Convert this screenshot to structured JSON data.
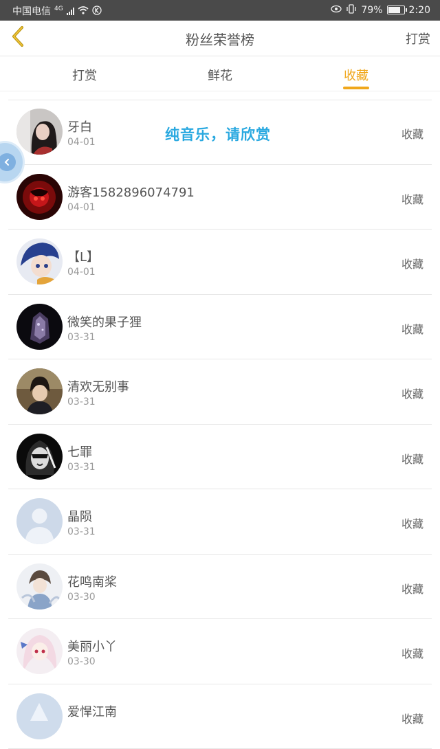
{
  "status_bar": {
    "carrier": "中国电信",
    "network": "4G",
    "battery": "79%",
    "battery_level": 0.79,
    "time": "2:20"
  },
  "header": {
    "title": "粉丝荣誉榜",
    "action_label": "打赏"
  },
  "tabs": [
    {
      "label": "打赏",
      "active": false
    },
    {
      "label": "鲜花",
      "active": false
    },
    {
      "label": "收藏",
      "active": true
    }
  ],
  "overlay_text": "纯音乐，请欣赏",
  "fans": [
    {
      "name": "牙白",
      "date": "04-01",
      "action": "收藏"
    },
    {
      "name": "游客1582896074791",
      "date": "04-01",
      "action": "收藏"
    },
    {
      "name": "【L】",
      "date": "04-01",
      "action": "收藏"
    },
    {
      "name": "微笑的果子狸",
      "date": "03-31",
      "action": "收藏"
    },
    {
      "name": "清欢无别事",
      "date": "03-31",
      "action": "收藏"
    },
    {
      "name": "七罪",
      "date": "03-31",
      "action": "收藏"
    },
    {
      "name": "晶陨",
      "date": "03-31",
      "action": "收藏"
    },
    {
      "name": "花鸣南桨",
      "date": "03-30",
      "action": "收藏"
    },
    {
      "name": "美丽小丫",
      "date": "03-30",
      "action": "收藏"
    },
    {
      "name": "爱悍江南",
      "date": "",
      "action": "收藏"
    }
  ],
  "colors": {
    "accent": "#f0a71b",
    "overlay_text": "#2aa9e0",
    "status_bar_bg": "#4a4a4a"
  }
}
